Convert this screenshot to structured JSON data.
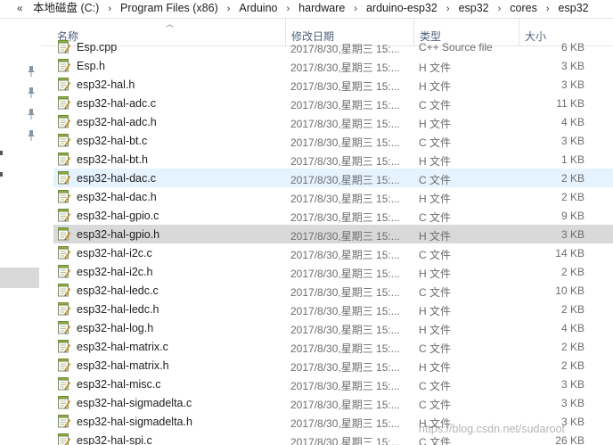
{
  "address_bar": {
    "chevron": "«",
    "crumbs": [
      "本地磁盘 (C:)",
      "Program Files (x86)",
      "Arduino",
      "hardware",
      "arduino-esp32",
      "esp32",
      "cores",
      "esp32"
    ]
  },
  "columns": {
    "name": "名称",
    "modified": "修改日期",
    "type": "类型",
    "size": "大小"
  },
  "files": [
    {
      "name": "Esp.cpp",
      "modified": "2017/8/30,星期三 15:...",
      "type": "C++ Source file",
      "size": "6 KB"
    },
    {
      "name": "Esp.h",
      "modified": "2017/8/30,星期三 15:...",
      "type": "H 文件",
      "size": "3 KB"
    },
    {
      "name": "esp32-hal.h",
      "modified": "2017/8/30,星期三 15:...",
      "type": "H 文件",
      "size": "3 KB"
    },
    {
      "name": "esp32-hal-adc.c",
      "modified": "2017/8/30,星期三 15:...",
      "type": "C 文件",
      "size": "11 KB"
    },
    {
      "name": "esp32-hal-adc.h",
      "modified": "2017/8/30,星期三 15:...",
      "type": "H 文件",
      "size": "4 KB"
    },
    {
      "name": "esp32-hal-bt.c",
      "modified": "2017/8/30,星期三 15:...",
      "type": "C 文件",
      "size": "3 KB"
    },
    {
      "name": "esp32-hal-bt.h",
      "modified": "2017/8/30,星期三 15:...",
      "type": "H 文件",
      "size": "1 KB"
    },
    {
      "name": "esp32-hal-dac.c",
      "modified": "2017/8/30,星期三 15:...",
      "type": "C 文件",
      "size": "2 KB"
    },
    {
      "name": "esp32-hal-dac.h",
      "modified": "2017/8/30,星期三 15:...",
      "type": "H 文件",
      "size": "2 KB"
    },
    {
      "name": "esp32-hal-gpio.c",
      "modified": "2017/8/30,星期三 15:...",
      "type": "C 文件",
      "size": "9 KB"
    },
    {
      "name": "esp32-hal-gpio.h",
      "modified": "2017/8/30,星期三 15:...",
      "type": "H 文件",
      "size": "3 KB"
    },
    {
      "name": "esp32-hal-i2c.c",
      "modified": "2017/8/30,星期三 15:...",
      "type": "C 文件",
      "size": "14 KB"
    },
    {
      "name": "esp32-hal-i2c.h",
      "modified": "2017/8/30,星期三 15:...",
      "type": "H 文件",
      "size": "2 KB"
    },
    {
      "name": "esp32-hal-ledc.c",
      "modified": "2017/8/30,星期三 15:...",
      "type": "C 文件",
      "size": "10 KB"
    },
    {
      "name": "esp32-hal-ledc.h",
      "modified": "2017/8/30,星期三 15:...",
      "type": "H 文件",
      "size": "2 KB"
    },
    {
      "name": "esp32-hal-log.h",
      "modified": "2017/8/30,星期三 15:...",
      "type": "H 文件",
      "size": "4 KB"
    },
    {
      "name": "esp32-hal-matrix.c",
      "modified": "2017/8/30,星期三 15:...",
      "type": "C 文件",
      "size": "2 KB"
    },
    {
      "name": "esp32-hal-matrix.h",
      "modified": "2017/8/30,星期三 15:...",
      "type": "H 文件",
      "size": "2 KB"
    },
    {
      "name": "esp32-hal-misc.c",
      "modified": "2017/8/30,星期三 15:...",
      "type": "C 文件",
      "size": "3 KB"
    },
    {
      "name": "esp32-hal-sigmadelta.c",
      "modified": "2017/8/30,星期三 15:...",
      "type": "C 文件",
      "size": "3 KB"
    },
    {
      "name": "esp32-hal-sigmadelta.h",
      "modified": "2017/8/30,星期三 15:...",
      "type": "H 文件",
      "size": "3 KB"
    },
    {
      "name": "esp32-hal-spi.c",
      "modified": "2017/8/30,星期三 15:...",
      "type": "C 文件",
      "size": "26 KB"
    }
  ],
  "hover_index": 7,
  "selected_index": 10,
  "watermark": "https://blog.csdn.net/sudaroot",
  "colors": {
    "hover_row": "#e5f3ff",
    "selected_row": "#d9d9d9",
    "header_text": "#4c607a"
  }
}
